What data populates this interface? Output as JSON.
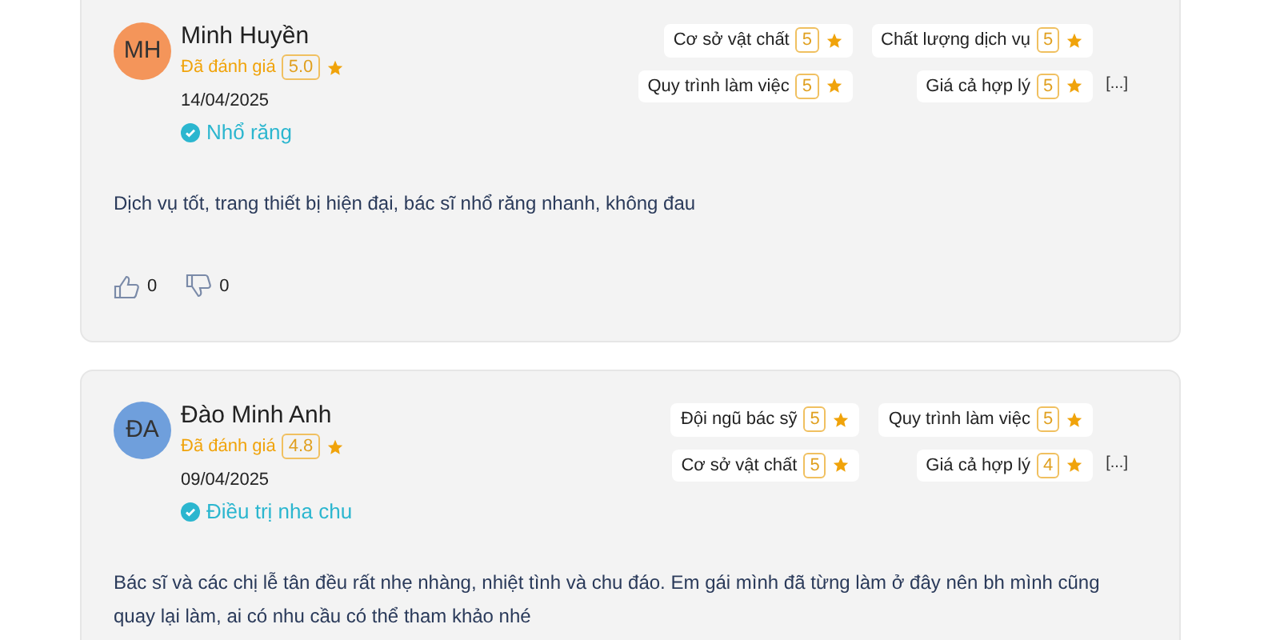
{
  "reviews": [
    {
      "initials": "MH",
      "color": "#f4955a",
      "name": "Minh Huyền",
      "rated_label": "Đã đánh giá",
      "score": "5.0",
      "date": "14/04/2025",
      "service": "Nhổ răng",
      "criteria": [
        {
          "label": "Cơ sở vật chất",
          "score": "5"
        },
        {
          "label": "Chất lượng dịch vụ",
          "score": "5"
        },
        {
          "label": "Quy trình làm việc",
          "score": "5"
        },
        {
          "label": "Giá cả hợp lý",
          "score": "5"
        }
      ],
      "more": "[...]",
      "comment": "Dịch vụ tốt, trang thiết bị hiện đại, bác sĩ nhổ răng nhanh, không đau",
      "likes": "0",
      "dislikes": "0"
    },
    {
      "initials": "ĐA",
      "color": "#6f9fdc",
      "name": "Đào Minh Anh",
      "rated_label": "Đã đánh giá",
      "score": "4.8",
      "date": "09/04/2025",
      "service": "Điều trị nha chu",
      "criteria": [
        {
          "label": "Đội ngũ bác sỹ",
          "score": "5"
        },
        {
          "label": "Quy trình làm việc",
          "score": "5"
        },
        {
          "label": "Cơ sở vật chất",
          "score": "5"
        },
        {
          "label": "Giá cả hợp lý",
          "score": "4"
        }
      ],
      "more": "[...]",
      "comment": "Bác sĩ và các chị lễ tân đều rất nhẹ nhàng, nhiệt tình và chu đáo. Em gái mình đã từng làm ở đây nên bh mình cũng quay lại làm, ai có nhu cầu có thể tham khảo nhé"
    }
  ]
}
